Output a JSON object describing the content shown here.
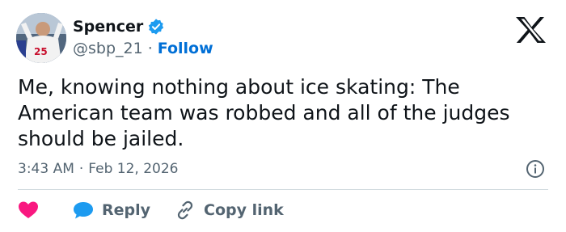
{
  "user": {
    "display_name": "Spencer",
    "handle": "@sbp_21",
    "separator": "·",
    "follow_label": "Follow",
    "avatar_icon": "baseball-player-avatar"
  },
  "tweet": {
    "text": "Me, knowing nothing about ice skating: The American team was robbed and all of the judges should be jailed.",
    "time": "3:43 AM",
    "separator": "·",
    "date": "Feb 12, 2026"
  },
  "actions": {
    "like_icon": "heart-icon",
    "reply_label": "Reply",
    "copy_link_label": "Copy link"
  },
  "colors": {
    "text": "#0f1419",
    "secondary": "#536471",
    "link": "#006fd6",
    "verified": "#1d9bf0",
    "heart": "#f91880",
    "reply_bubble": "#1d9bf0",
    "divider": "#cfd9de"
  }
}
